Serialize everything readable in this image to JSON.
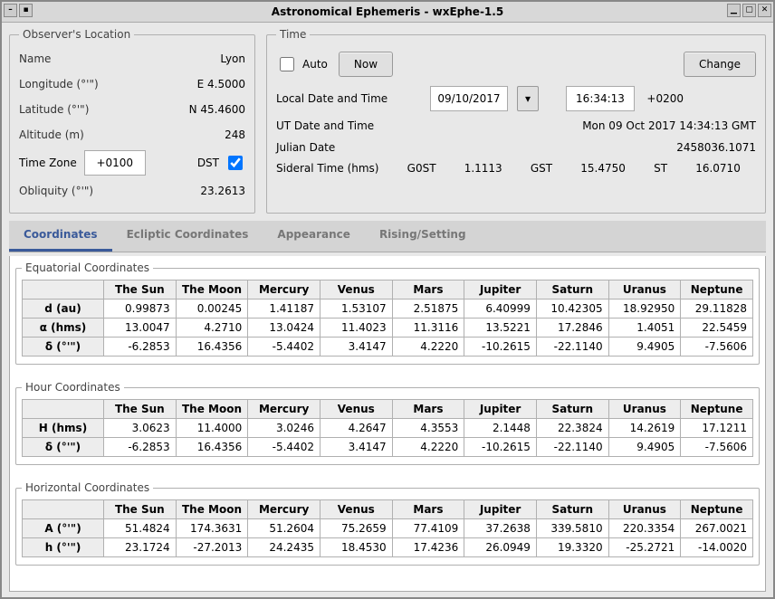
{
  "window": {
    "title": "Astronomical Ephemeris - wxEphe-1.5"
  },
  "location": {
    "legend": "Observer's Location",
    "labels": {
      "name": "Name",
      "longitude": "Longitude (°'\")",
      "latitude": "Latitude (°'\")",
      "altitude": "Altitude (m)",
      "timezone": "Time Zone",
      "dst": "DST",
      "obliquity": "Obliquity (°'\")"
    },
    "values": {
      "name": "Lyon",
      "longitude": "E    4.5000",
      "latitude": "N  45.4600",
      "altitude": "248",
      "timezone": "+0100",
      "obliquity": "23.2613"
    },
    "dst_checked": true
  },
  "time": {
    "legend": "Time",
    "auto_label": "Auto",
    "now_label": "Now",
    "change_label": "Change",
    "local_label": "Local Date and Time",
    "ut_label": "UT Date and Time",
    "julian_label": "Julian Date",
    "sideral_label": "Sideral Time (hms)",
    "date_value": "09/10/2017",
    "time_value": "16:34:13",
    "tz_offset": "+0200",
    "ut_value": "Mon 09 Oct 2017 14:34:13 GMT",
    "julian_value": "2458036.1071",
    "sideral": {
      "g0st_label": "G0ST",
      "g0st": "1.1113",
      "gst_label": "GST",
      "gst": "15.4750",
      "st_label": "ST",
      "st": "16.0710"
    }
  },
  "tabs": {
    "coordinates": "Coordinates",
    "ecliptic": "Ecliptic Coordinates",
    "appearance": "Appearance",
    "rising": "Rising/Setting"
  },
  "bodies": [
    "The Sun",
    "The Moon",
    "Mercury",
    "Venus",
    "Mars",
    "Jupiter",
    "Saturn",
    "Uranus",
    "Neptune"
  ],
  "sections": {
    "equatorial": {
      "legend": "Equatorial Coordinates",
      "rows": {
        "d": {
          "label": "d (au)",
          "vals": [
            "0.99873",
            "0.00245",
            "1.41187",
            "1.53107",
            "2.51875",
            "6.40999",
            "10.42305",
            "18.92950",
            "29.11828"
          ]
        },
        "alpha": {
          "label": "α (hms)",
          "vals": [
            "13.0047",
            "4.2710",
            "13.0424",
            "11.4023",
            "11.3116",
            "13.5221",
            "17.2846",
            "1.4051",
            "22.5459"
          ]
        },
        "delta": {
          "label": "δ (°'\")",
          "vals": [
            "-6.2853",
            "16.4356",
            "-5.4402",
            "3.4147",
            "4.2220",
            "-10.2615",
            "-22.1140",
            "9.4905",
            "-7.5606"
          ]
        }
      }
    },
    "hour": {
      "legend": "Hour Coordinates",
      "rows": {
        "H": {
          "label": "H (hms)",
          "vals": [
            "3.0623",
            "11.4000",
            "3.0246",
            "4.2647",
            "4.3553",
            "2.1448",
            "22.3824",
            "14.2619",
            "17.1211"
          ]
        },
        "delta": {
          "label": "δ (°'\")",
          "vals": [
            "-6.2853",
            "16.4356",
            "-5.4402",
            "3.4147",
            "4.2220",
            "-10.2615",
            "-22.1140",
            "9.4905",
            "-7.5606"
          ]
        }
      }
    },
    "horizontal": {
      "legend": "Horizontal Coordinates",
      "rows": {
        "A": {
          "label": "A (°'\")",
          "vals": [
            "51.4824",
            "174.3631",
            "51.2604",
            "75.2659",
            "77.4109",
            "37.2638",
            "339.5810",
            "220.3354",
            "267.0021"
          ]
        },
        "h": {
          "label": "h (°'\")",
          "vals": [
            "23.1724",
            "-27.2013",
            "24.2435",
            "18.4530",
            "17.4236",
            "26.0949",
            "19.3320",
            "-25.2721",
            "-14.0020"
          ]
        }
      }
    }
  }
}
